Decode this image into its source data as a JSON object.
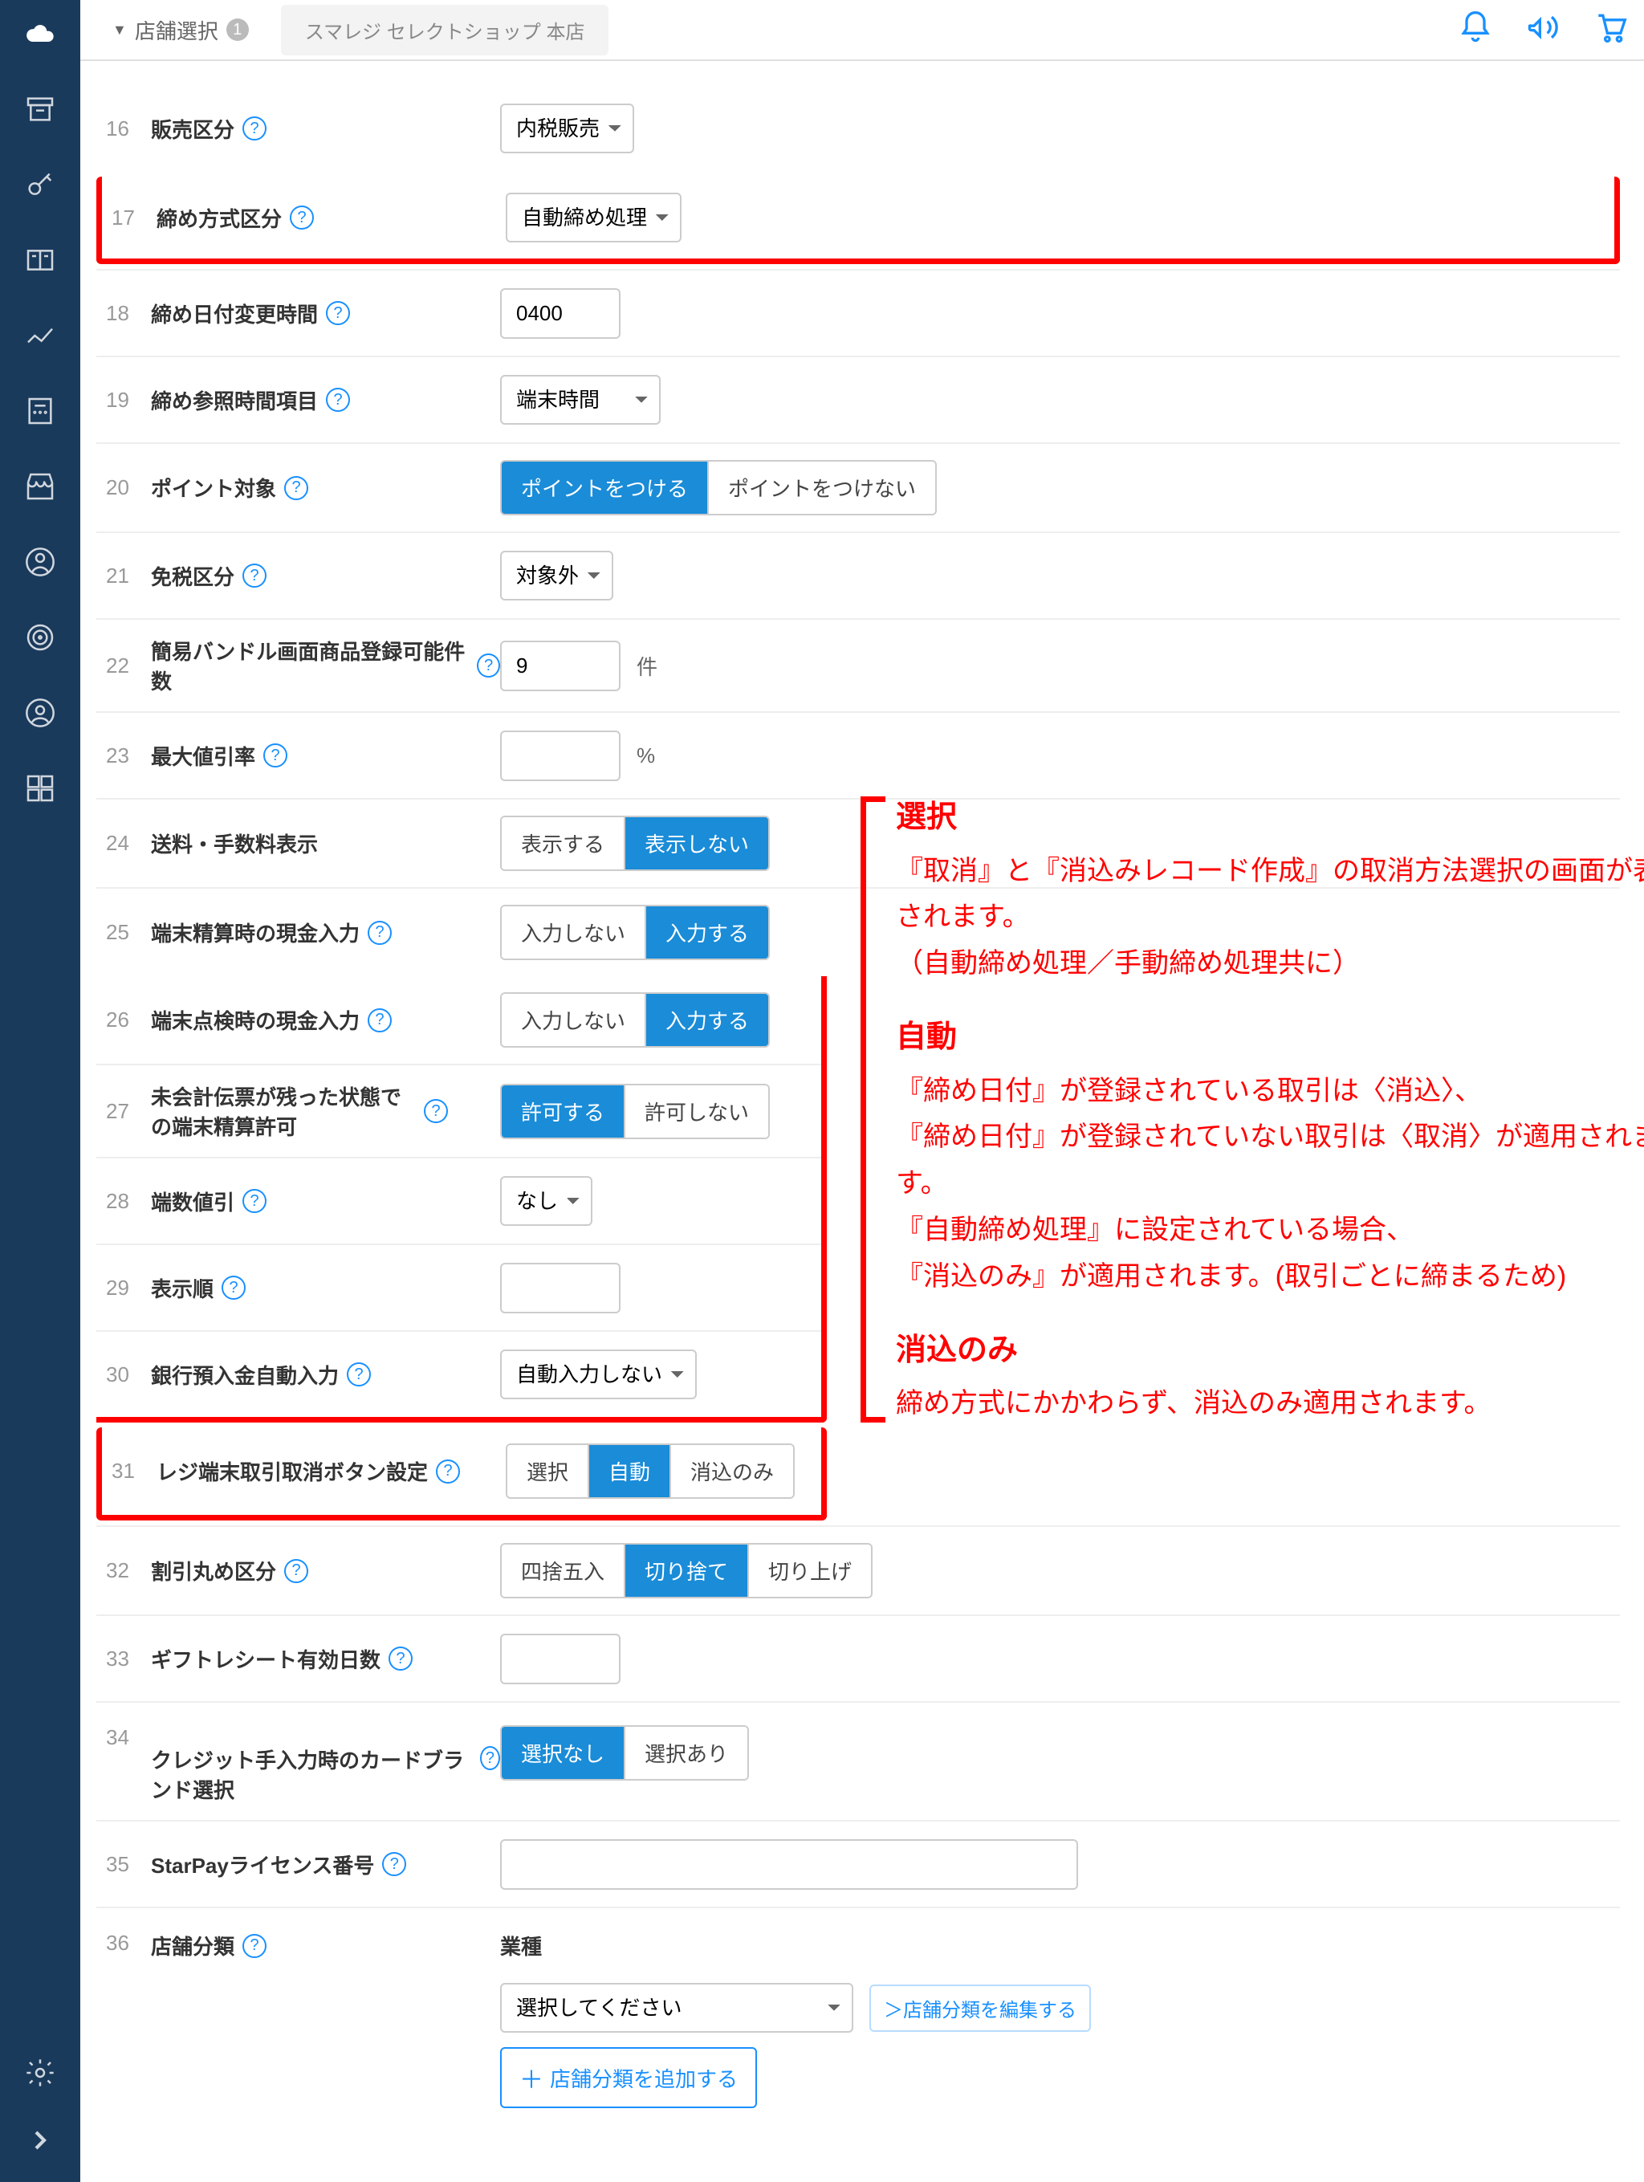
{
  "topbar": {
    "store_select_label": "店舗選択",
    "store_count": "1",
    "store_name": "スマレジ セレクトショップ 本店"
  },
  "rows": {
    "r16": {
      "num": "16",
      "label": "販売区分",
      "value": "内税販売"
    },
    "r17": {
      "num": "17",
      "label": "締め方式区分",
      "value": "自動締め処理"
    },
    "r18": {
      "num": "18",
      "label": "締め日付変更時間",
      "value": "0400"
    },
    "r19": {
      "num": "19",
      "label": "締め参照時間項目",
      "value": "端末時間"
    },
    "r20": {
      "num": "20",
      "label": "ポイント対象",
      "opt1": "ポイントをつける",
      "opt2": "ポイントをつけない"
    },
    "r21": {
      "num": "21",
      "label": "免税区分",
      "value": "対象外"
    },
    "r22": {
      "num": "22",
      "label": "簡易バンドル画面商品登録可能件数",
      "value": "9",
      "unit": "件"
    },
    "r23": {
      "num": "23",
      "label": "最大値引率",
      "value": "",
      "unit": "%"
    },
    "r24": {
      "num": "24",
      "label": "送料・手数料表示",
      "opt1": "表示する",
      "opt2": "表示しない"
    },
    "r25": {
      "num": "25",
      "label": "端末精算時の現金入力",
      "opt1": "入力しない",
      "opt2": "入力する"
    },
    "r26": {
      "num": "26",
      "label": "端末点検時の現金入力",
      "opt1": "入力しない",
      "opt2": "入力する"
    },
    "r27": {
      "num": "27",
      "label": "未会計伝票が残った状態での端末精算許可",
      "opt1": "許可する",
      "opt2": "許可しない"
    },
    "r28": {
      "num": "28",
      "label": "端数値引",
      "value": "なし"
    },
    "r29": {
      "num": "29",
      "label": "表示順",
      "value": ""
    },
    "r30": {
      "num": "30",
      "label": "銀行預入金自動入力",
      "value": "自動入力しない"
    },
    "r31": {
      "num": "31",
      "label": "レジ端末取引取消ボタン設定",
      "opt1": "選択",
      "opt2": "自動",
      "opt3": "消込のみ"
    },
    "r32": {
      "num": "32",
      "label": "割引丸め区分",
      "opt1": "四捨五入",
      "opt2": "切り捨て",
      "opt3": "切り上げ"
    },
    "r33": {
      "num": "33",
      "label": "ギフトレシート有効日数",
      "value": ""
    },
    "r34": {
      "num": "34",
      "label": "クレジット手入力時のカードブランド選択",
      "opt1": "選択なし",
      "opt2": "選択あり"
    },
    "r35": {
      "num": "35",
      "label": "StarPayライセンス番号",
      "value": ""
    },
    "r36": {
      "num": "36",
      "label": "店舗分類",
      "sublabel": "業種",
      "value": "選択してください",
      "link": "＞店舗分類を編集する",
      "add": "店舗分類を追加する"
    }
  },
  "annotation": {
    "h1": "選択",
    "p1": "『取消』と『消込みレコード作成』の取消方法選択の画面が表示されます。\n（自動締め処理／手動締め処理共に）",
    "h2": "自動",
    "p2": "『締め日付』が登録されている取引は〈消込〉、\n『締め日付』が登録されていない取引は〈取消〉が適用されます。\n『自動締め処理』に設定されている場合、\n『消込のみ』が適用されます。(取引ごとに締まるため)",
    "h3": "消込のみ",
    "p3": "締め方式にかかわらず、消込のみ適用されます。"
  }
}
